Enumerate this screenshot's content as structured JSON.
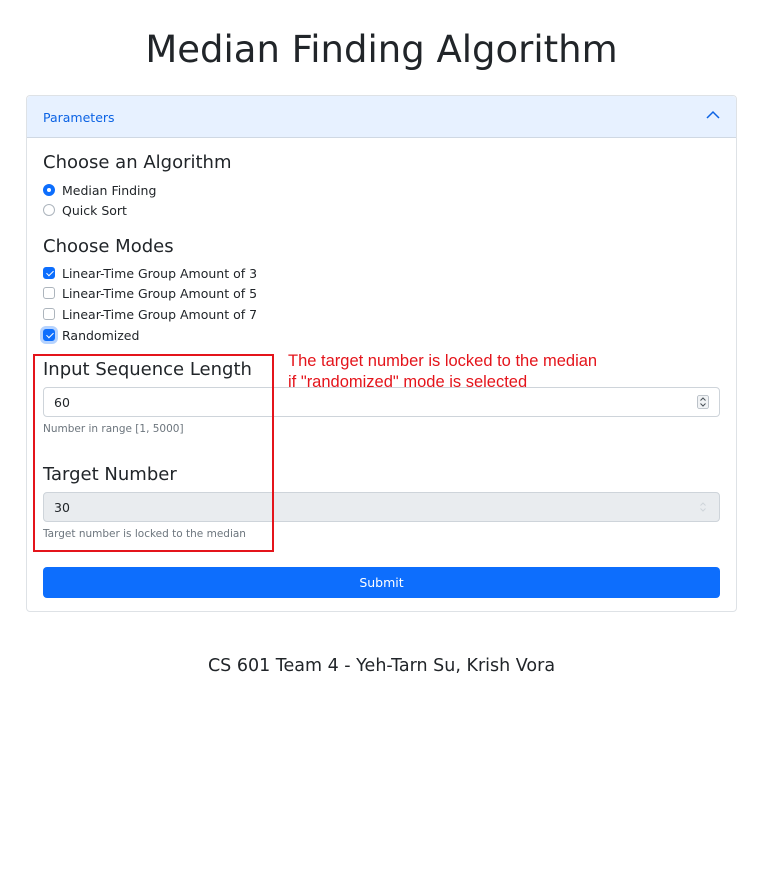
{
  "title": "Median Finding Algorithm",
  "accordion": {
    "header": "Parameters",
    "expanded": true
  },
  "algorithm": {
    "heading": "Choose an Algorithm",
    "options": [
      {
        "label": "Median Finding",
        "selected": true
      },
      {
        "label": "Quick Sort",
        "selected": false
      }
    ]
  },
  "modes": {
    "heading": "Choose Modes",
    "options": [
      {
        "label": "Linear-Time Group Amount of 3",
        "checked": true
      },
      {
        "label": "Linear-Time Group Amount of 5",
        "checked": false
      },
      {
        "label": "Linear-Time Group Amount of 7",
        "checked": false
      },
      {
        "label": "Randomized",
        "checked": true
      }
    ]
  },
  "sequence_length": {
    "heading": "Input Sequence Length",
    "value": "60",
    "help": "Number in range [1, 5000]"
  },
  "target_number": {
    "heading": "Target Number",
    "value": "30",
    "disabled": true,
    "help": "Target number is locked to the median"
  },
  "submit_label": "Submit",
  "annotation": {
    "line1": "The target number is locked to the median",
    "line2": "if \"randomized\" mode is selected",
    "color": "#e4141b"
  },
  "footer": "CS 601 Team 4 - Yeh-Tarn Su, Krish Vora",
  "colors": {
    "primary": "#0d6efd",
    "accordion_header_bg": "#e7f1ff",
    "accordion_header_text": "#0c63e4"
  }
}
